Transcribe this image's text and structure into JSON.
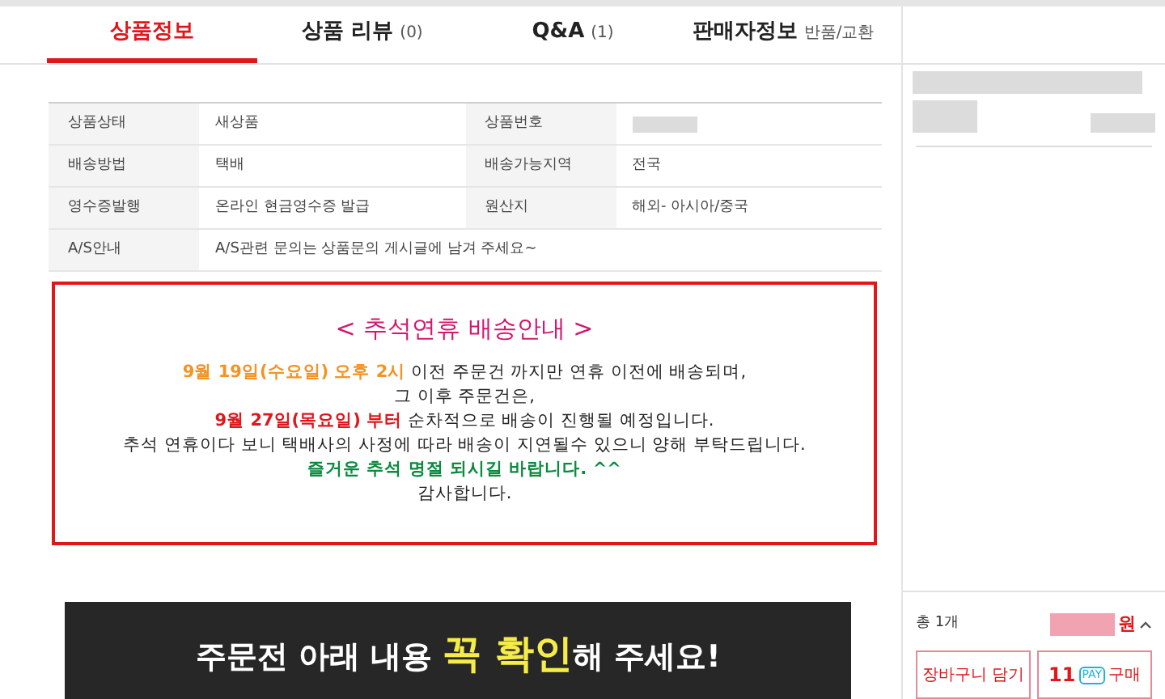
{
  "tabs": [
    {
      "label": "상품정보",
      "selected": true
    },
    {
      "label": "상품 리뷰",
      "count": "(0)",
      "selected": false
    },
    {
      "label": "Q&A",
      "count": "(1)",
      "selected": false
    },
    {
      "label": "판매자정보",
      "count": "반품/교환",
      "selected": false
    }
  ],
  "info_table": {
    "rows": [
      {
        "cells": [
          {
            "label": "상품상태",
            "value": "새상품"
          },
          {
            "label": "상품번호"
          }
        ]
      },
      {
        "cells": [
          {
            "label": "배송방법",
            "value": "택배"
          },
          {
            "label": "배송가능지역",
            "value": "전국"
          }
        ]
      },
      {
        "cells": [
          {
            "label": "영수증발행",
            "value": "온라인 현금영수증 발급"
          },
          {
            "label": "원산지",
            "value": "해외- 아시아/중국"
          }
        ]
      },
      {
        "cells": [
          {
            "label": "A/S안내",
            "value": "A/S관련 문의는 상품문의 게시글에 남겨 주세요~"
          }
        ]
      }
    ]
  },
  "notice": {
    "title": "< 추석연휴 배송안내 >",
    "lines": [
      [
        {
          "text": "9월 19일(수요일) 오후 2시",
          "color": "#f39325",
          "bold": true
        },
        {
          "text": " 이전 주문건 까지만 연휴 이전에 배송되며,"
        }
      ],
      [
        {
          "text": "그 이후 주문건은,"
        }
      ],
      [
        {
          "text": "9월 27일(목요일) 부터",
          "color": "#e0161b",
          "bold": true
        },
        {
          "text": " 순차적으로 배송이 진행될 예정입니다."
        }
      ],
      [
        {
          "text": "추석 연휴이다 보니 택배사의 사정에 따라 배송이 지연될수 있으니 양해 부탁드립니다."
        }
      ],
      [
        {
          "text": "즐거운 추석 명절 되시길 바랍니다. ^^",
          "color": "#0b8a3e",
          "bold": true
        }
      ],
      [
        {
          "text": "감사합니다."
        }
      ]
    ]
  },
  "banner": {
    "segments": [
      {
        "text": "주문전 아래 내용 ",
        "highlight": false
      },
      {
        "text": "꼭 확인",
        "highlight": true
      },
      {
        "text": "해 주세요!",
        "highlight": false
      }
    ]
  },
  "sidebar": {
    "quantity": "총 1개",
    "currency": "원",
    "buttons": [
      {
        "kind": "cart",
        "label": "장바구니 담기"
      },
      {
        "kind": "pay",
        "logo": "11",
        "badge": "PAY",
        "label": "구매"
      }
    ]
  }
}
